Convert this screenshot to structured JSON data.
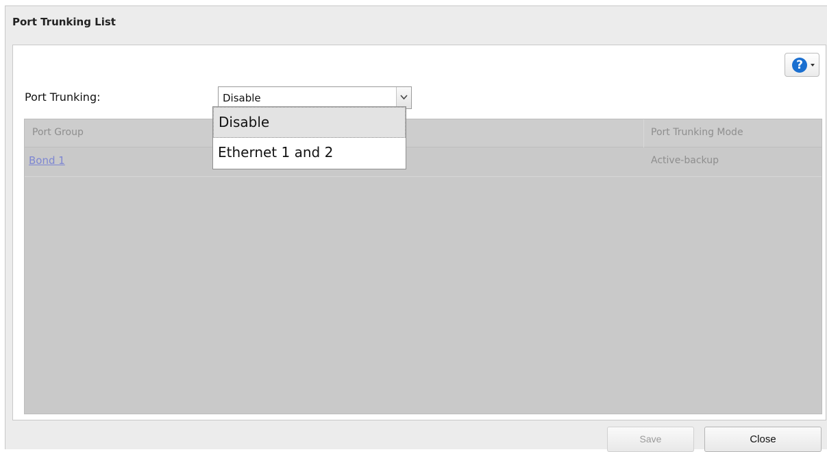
{
  "dialog": {
    "title": "Port Trunking List"
  },
  "help": {
    "icon": "help-icon",
    "glyph": "?"
  },
  "port_trunking": {
    "label": "Port Trunking:",
    "selected": "Disable",
    "options": [
      "Disable",
      "Ethernet 1 and 2"
    ],
    "highlighted_option": "Disable"
  },
  "table": {
    "columns": [
      "Port Group",
      "Port Trunking Mode"
    ],
    "rows": [
      {
        "port_group": "Bond 1",
        "mode": "Active-backup"
      }
    ]
  },
  "buttons": {
    "save": "Save",
    "close": "Close"
  }
}
